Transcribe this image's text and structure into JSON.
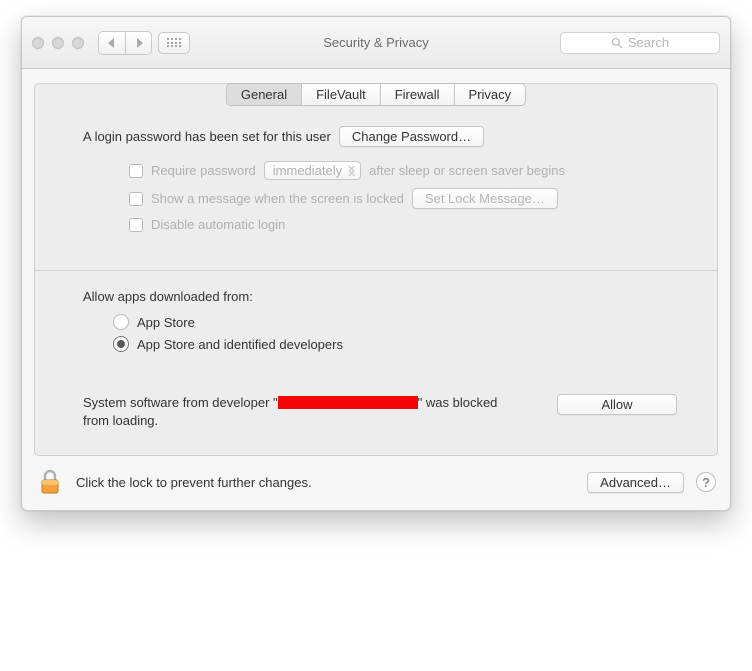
{
  "window": {
    "title": "Security & Privacy",
    "search_placeholder": "Search"
  },
  "tabs": {
    "general": "General",
    "filevault": "FileVault",
    "firewall": "Firewall",
    "privacy": "Privacy",
    "active": "general"
  },
  "login": {
    "status_text": "A login password has been set for this user",
    "change_button": "Change Password…",
    "require_label": "Require password",
    "require_delay": "immediately",
    "require_suffix": "after sleep or screen saver begins",
    "show_message_label": "Show a message when the screen is locked",
    "set_lock_button": "Set Lock Message…",
    "disable_auto_login": "Disable automatic login"
  },
  "download": {
    "header": "Allow apps downloaded from:",
    "opt_appstore": "App Store",
    "opt_identified": "App Store and identified developers",
    "selected": "identified"
  },
  "blocked": {
    "prefix": "System software from developer \"",
    "suffix": "\" was blocked from loading.",
    "allow_button": "Allow"
  },
  "footer": {
    "lock_text": "Click the lock to prevent further changes.",
    "advanced_button": "Advanced…",
    "help": "?"
  }
}
